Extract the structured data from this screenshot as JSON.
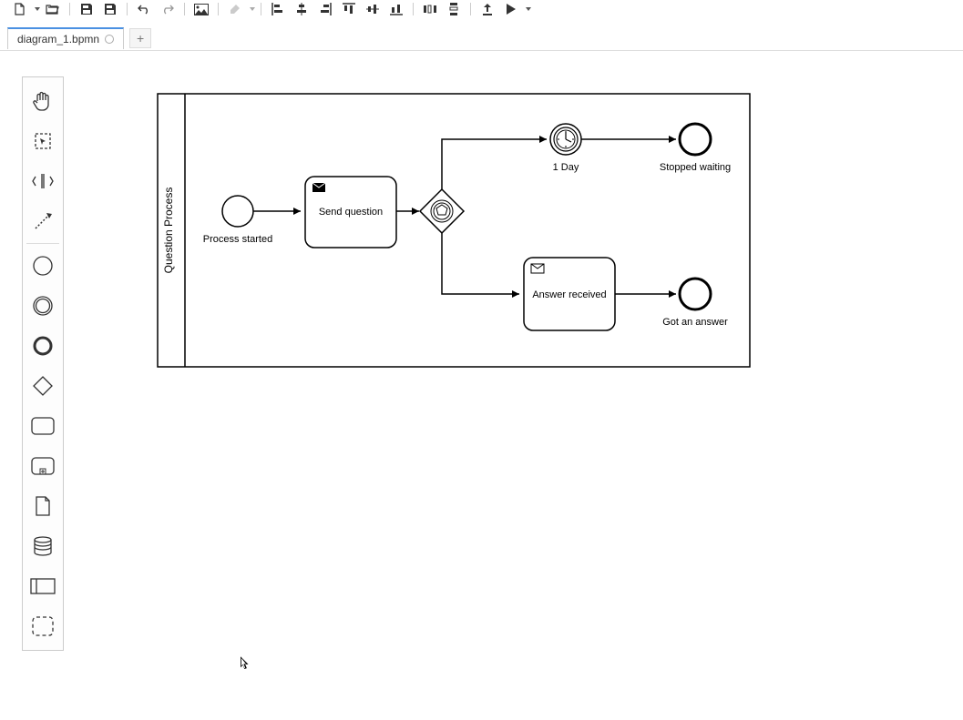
{
  "toolbar": {
    "icons": [
      "new-file",
      "open-folder",
      "save",
      "save-as",
      "undo",
      "redo",
      "image",
      "paint",
      "align-left",
      "align-center",
      "align-right",
      "align-top",
      "align-middle",
      "align-bottom",
      "distribute-h",
      "distribute-v",
      "upload",
      "play"
    ]
  },
  "tabs": {
    "active": "diagram_1.bpmn",
    "add_label": "+"
  },
  "palette": {
    "tools": [
      "hand-tool",
      "lasso-tool",
      "space-tool",
      "connect-tool",
      "start-event",
      "intermediate-event",
      "end-event",
      "gateway",
      "task",
      "subprocess",
      "data-object",
      "data-store",
      "participant",
      "group"
    ]
  },
  "diagram": {
    "lane_label": "Question Process",
    "start_event_label": "Process started",
    "task_send_label": "Send question",
    "timer_label": "1 Day",
    "end_stopped_label": "Stopped waiting",
    "task_answer_label": "Answer received",
    "end_answer_label": "Got an answer"
  }
}
